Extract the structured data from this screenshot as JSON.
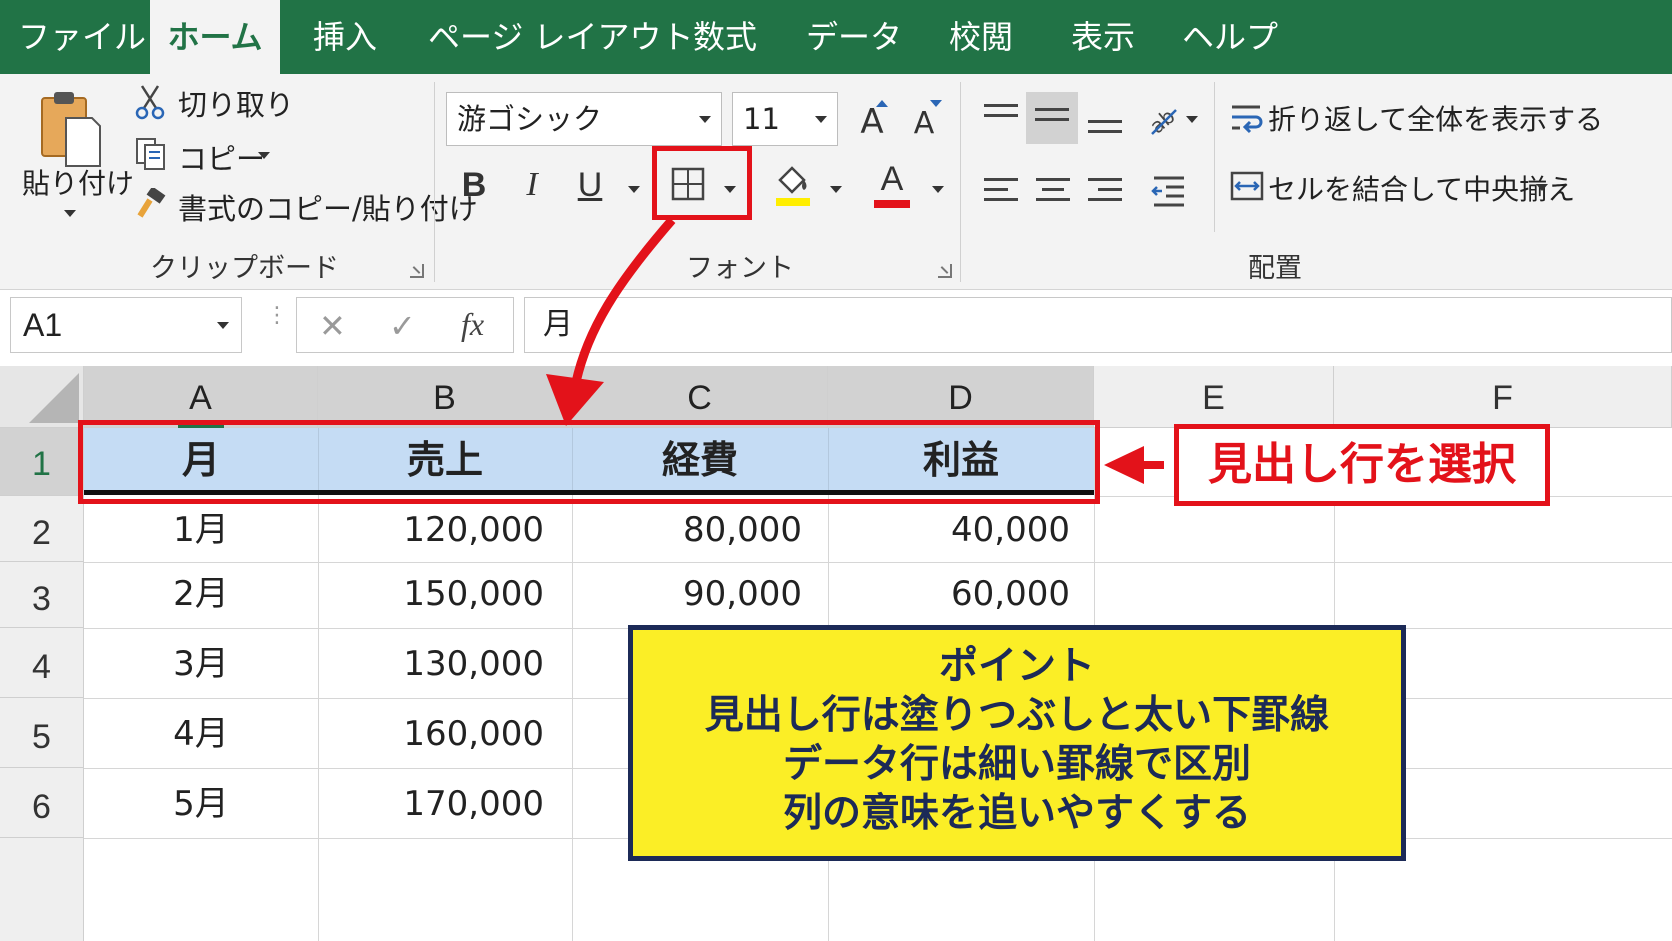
{
  "ribbon": {
    "tabs": [
      "ファイル",
      "ホーム",
      "挿入",
      "ページ レイアウト",
      "数式",
      "データ",
      "校閲",
      "表示",
      "ヘルプ"
    ],
    "active_tab": "ホーム",
    "clipboard": {
      "paste_label": "貼り付け",
      "cut_label": "切り取り",
      "copy_label": "コピー",
      "format_painter_label": "書式のコピー/貼り付け",
      "group_label": "クリップボード"
    },
    "font": {
      "font_name": "游ゴシック",
      "font_size": "11",
      "bold": "B",
      "italic": "I",
      "underline": "U",
      "font_color_letter": "A",
      "grow_letter": "A",
      "shrink_letter": "A",
      "group_label": "フォント",
      "fill_color": "#ffee00",
      "font_color": "#e3121a"
    },
    "alignment": {
      "wrap_text_label": "折り返して全体を表示する",
      "merge_center_label": "セルを結合して中央揃え",
      "group_label": "配置"
    }
  },
  "formula_bar": {
    "name_box": "A1",
    "fx": "fx",
    "content": "月"
  },
  "sheet": {
    "columns": [
      "A",
      "B",
      "C",
      "D",
      "E",
      "F"
    ],
    "rows": [
      "1",
      "2",
      "3",
      "4",
      "5",
      "6"
    ],
    "header_row": [
      "月",
      "売上",
      "経費",
      "利益"
    ],
    "data": [
      [
        "1月",
        "120,000",
        "80,000",
        "40,000"
      ],
      [
        "2月",
        "150,000",
        "90,000",
        "60,000"
      ],
      [
        "3月",
        "130,000"
      ],
      [
        "4月",
        "160,000"
      ],
      [
        "5月",
        "170,000"
      ]
    ],
    "header_fill": "#c5dcf4"
  },
  "annotations": {
    "select_label": "見出し行を選択",
    "note_lines": [
      "ポイント",
      "見出し行は塗りつぶしと太い下罫線",
      "データ行は細い罫線で区別",
      "列の意味を追いやすくする"
    ],
    "accent_red": "#e3121a",
    "note_fill": "#fbee26",
    "note_border": "#1c2a57"
  }
}
